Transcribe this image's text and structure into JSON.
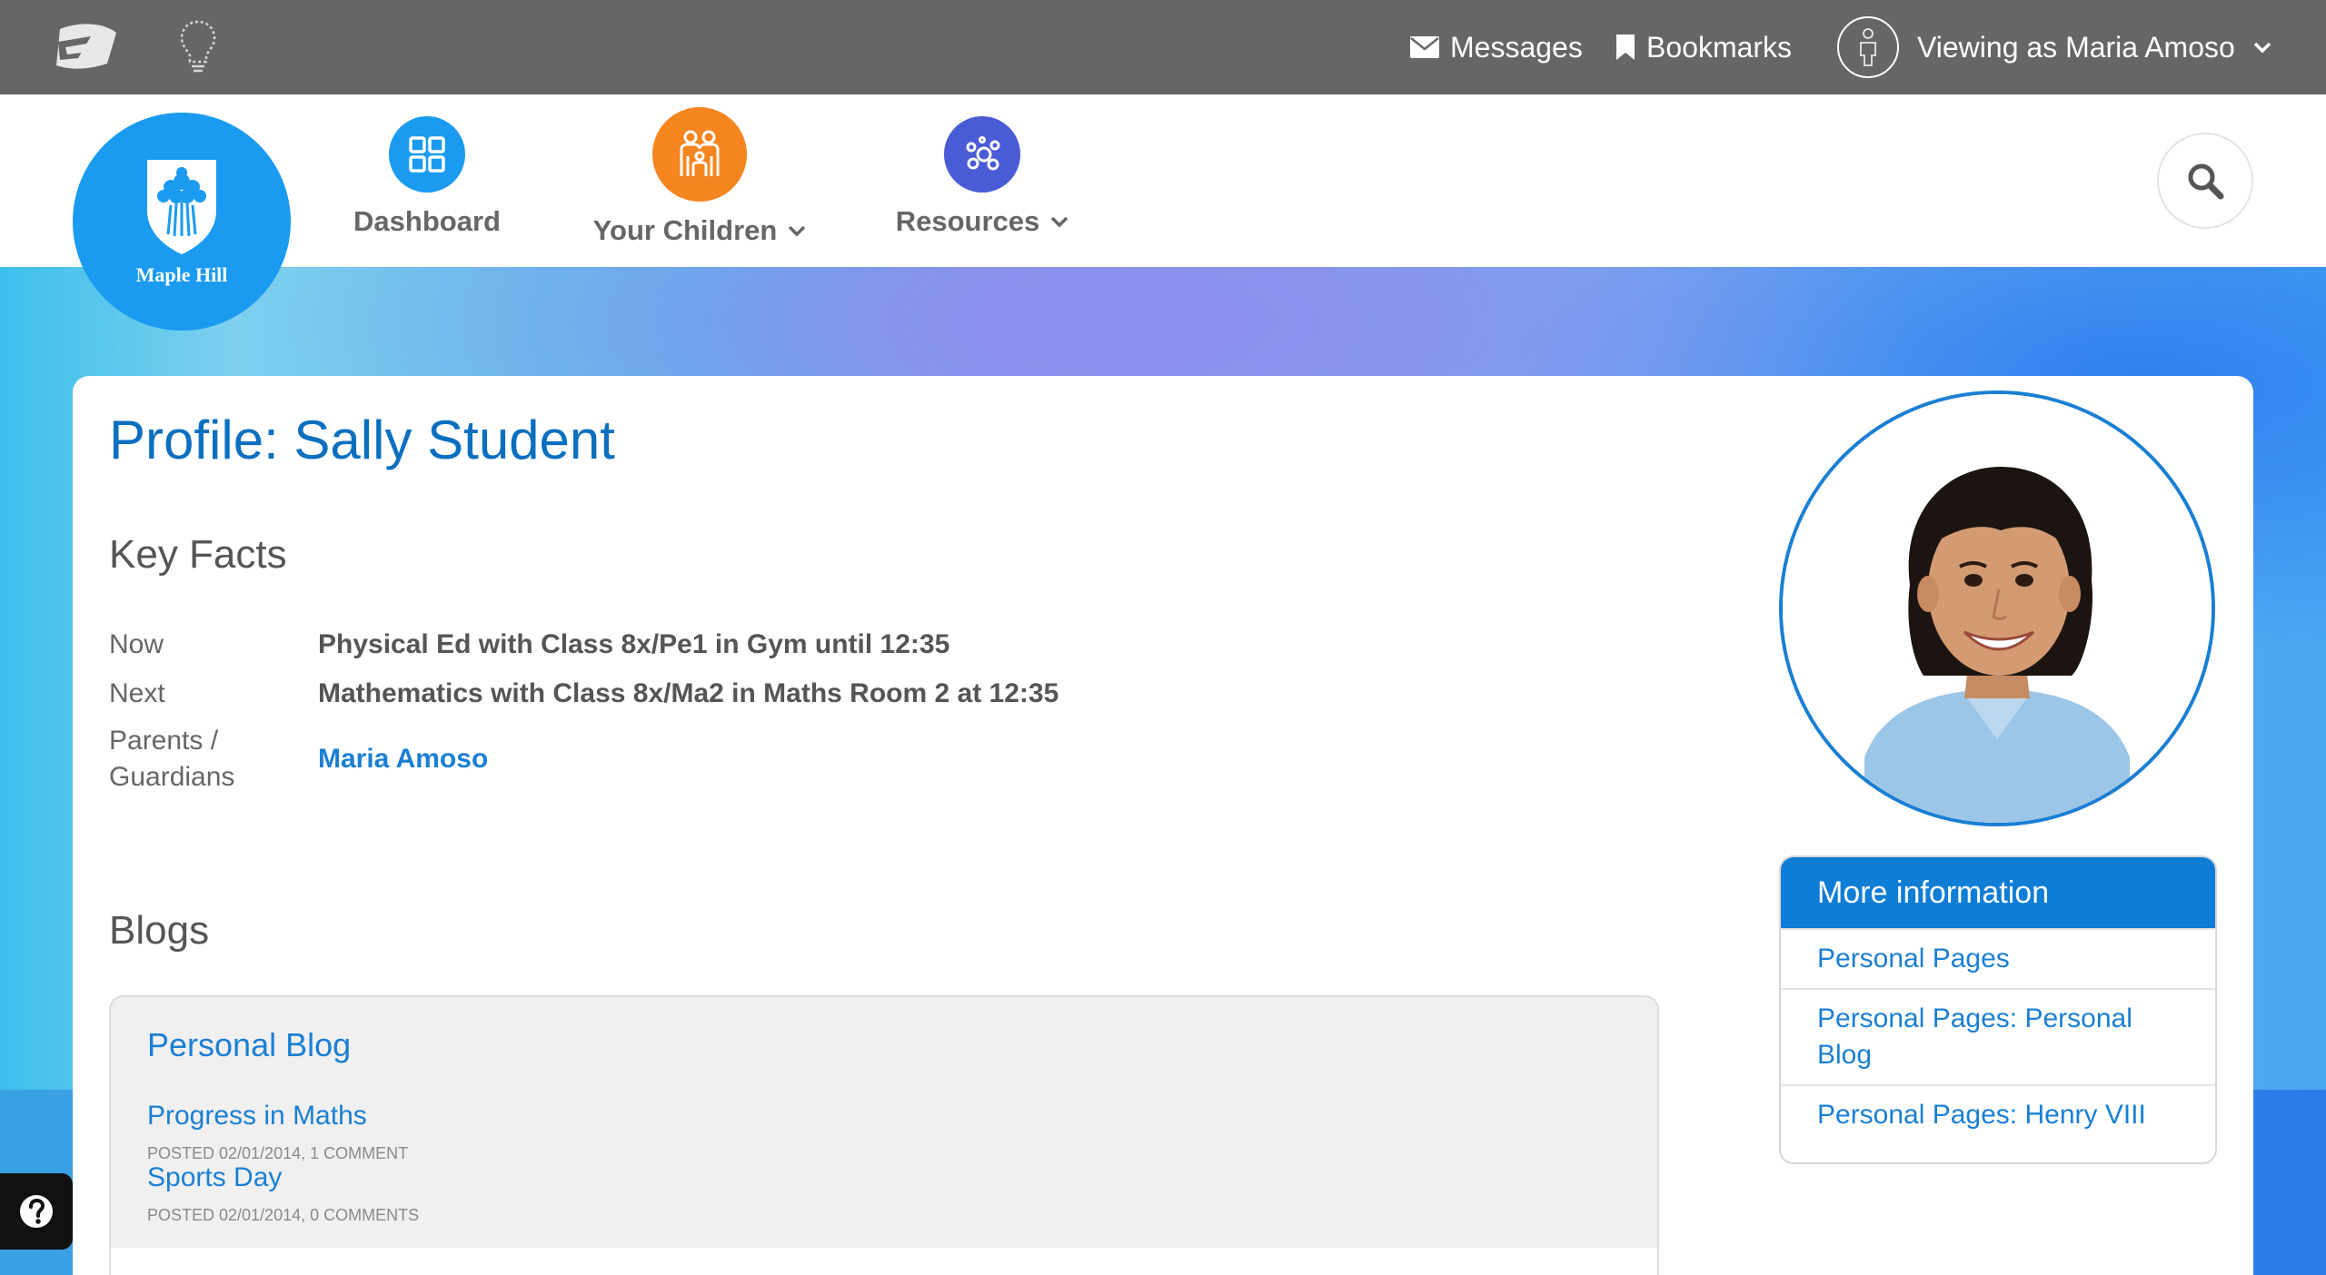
{
  "topbar": {
    "messages_label": "Messages",
    "bookmarks_label": "Bookmarks",
    "viewing_as_label": "Viewing as Maria Amoso"
  },
  "school": {
    "name": "Maple Hill"
  },
  "nav": {
    "dashboard_label": "Dashboard",
    "children_label": "Your Children",
    "resources_label": "Resources"
  },
  "profile": {
    "title": "Profile: Sally Student",
    "key_facts_heading": "Key Facts",
    "facts": [
      {
        "label": "Now",
        "value": "Physical Ed with Class 8x/Pe1 in Gym until 12:35"
      },
      {
        "label": "Next",
        "value": "Mathematics with Class 8x/Ma2 in Maths Room 2 at 12:35"
      },
      {
        "label": "Parents / Guardians",
        "value": "Maria Amoso"
      }
    ]
  },
  "blogs": {
    "heading": "Blogs",
    "blog_title": "Personal Blog",
    "posts": [
      {
        "title": "Progress in Maths",
        "meta": "POSTED 02/01/2014, 1 COMMENT"
      },
      {
        "title": "Sports Day",
        "meta": "POSTED 02/01/2014, 0 COMMENTS"
      }
    ]
  },
  "more_info": {
    "heading": "More information",
    "links": [
      "Personal Pages",
      "Personal Pages: Personal Blog",
      "Personal Pages: Henry VIII"
    ]
  },
  "colors": {
    "topbar": "#666666",
    "accent_blue": "#0d7dd6",
    "link_blue": "#1a7fd4",
    "dashboard_icon": "#1a9bf0",
    "children_icon": "#f5851f",
    "resources_icon": "#4a5bd6"
  },
  "icons": {
    "brand": "brand-logo-icon",
    "bulb": "lightbulb-icon",
    "messages": "envelope-icon",
    "bookmarks": "bookmark-icon",
    "user": "user-icon",
    "dashboard": "grid-icon",
    "children": "family-icon",
    "resources": "bubbles-icon",
    "search": "search-icon",
    "help": "question-icon"
  }
}
